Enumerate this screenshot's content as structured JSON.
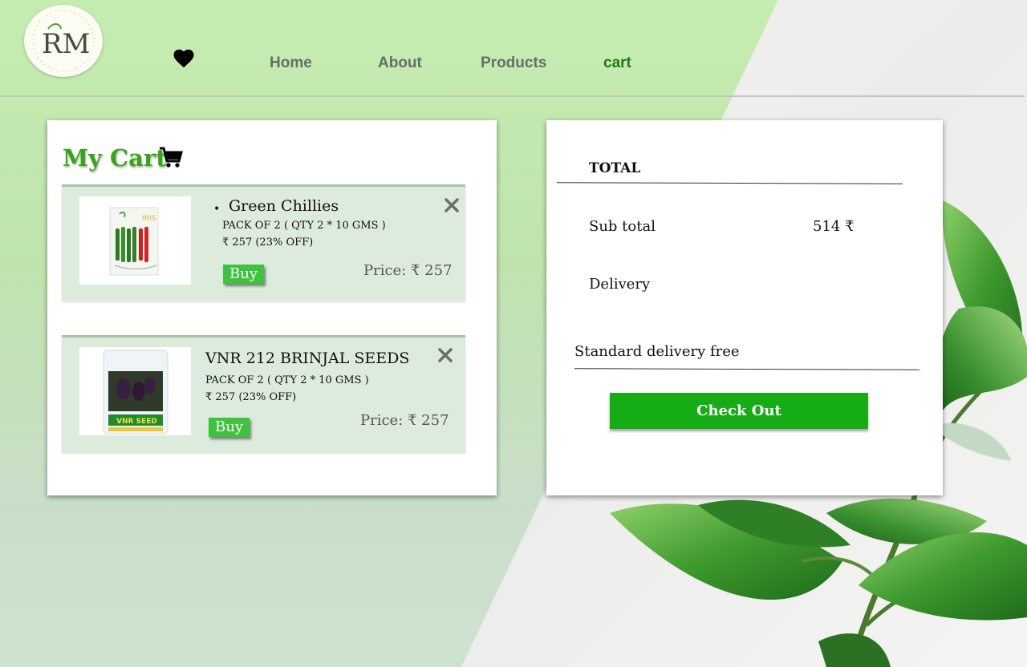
{
  "header": {
    "logo_text": "RM",
    "nav": [
      {
        "label": "Home"
      },
      {
        "label": "About"
      },
      {
        "label": "Products"
      },
      {
        "label": "cart"
      }
    ],
    "active_nav": "cart"
  },
  "cart": {
    "title": "My Cart",
    "items": [
      {
        "name": "Green Chillies",
        "pack": "PACK OF 2 ( QTY 2 * 10 GMS )",
        "offer": "₹ 257 (23% OFF)",
        "buy_label": "Buy",
        "price": "Price: ₹ 257",
        "brand_text": "IRIS"
      },
      {
        "name": "VNR 212 BRINJAL SEEDS",
        "pack": "PACK OF 2 ( QTY 2 * 10 GMS )",
        "offer": "₹ 257 (23% OFF)",
        "buy_label": "Buy",
        "price": "Price: ₹ 257",
        "brand_text": "VNR SEED"
      }
    ]
  },
  "summary": {
    "heading": "TOTAL",
    "subtotal_label": "Sub total",
    "subtotal_value": "514 ₹",
    "delivery_label": "Delivery",
    "delivery_note": "Standard delivery free",
    "checkout_label": "Check Out"
  },
  "colors": {
    "accent_green": "#15ac15",
    "title_green": "#3aa31b",
    "active_nav": "#1e7a0f"
  }
}
